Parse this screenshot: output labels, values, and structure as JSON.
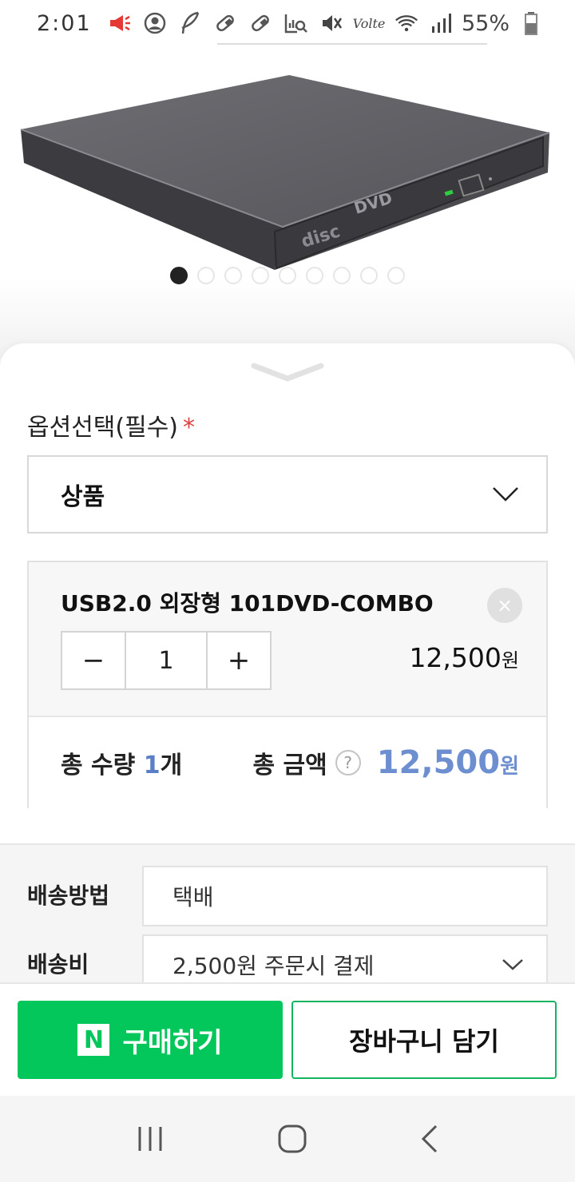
{
  "status_bar": {
    "time": "2:01",
    "battery": "55%",
    "icons_left": [
      "megaphone-icon",
      "account-circle-icon",
      "feather-icon",
      "pill-icon",
      "pill-icon",
      "chart-search-icon"
    ],
    "icons_right": [
      "mute-icon",
      "volte-icon",
      "wifi-icon",
      "signal-icon",
      "battery-icon"
    ],
    "volte_label": "Volte"
  },
  "product_image": {
    "dots_total": 9,
    "active_index": 0
  },
  "option": {
    "label": "옵션선택(필수)",
    "required_mark": "*",
    "selected": "상품"
  },
  "cart_item": {
    "name": "USB2.0 외장형 101DVD-COMBO",
    "quantity": "1",
    "price": "12,500",
    "price_unit": "원",
    "minus": "−",
    "plus": "+",
    "remove": "×"
  },
  "summary": {
    "qty_label": "총 수량",
    "qty_value": "1",
    "qty_unit": "개",
    "amount_label": "총 금액",
    "help": "?",
    "amount_value": "12,500",
    "amount_unit": "원"
  },
  "delivery": {
    "method_label": "배송방법",
    "method_value": "택배",
    "fee_label": "배송비",
    "fee_value": "2,500원 주문시 결제"
  },
  "actions": {
    "buy_logo": "N",
    "buy_label": "구매하기",
    "cart_label": "장바구니 담기"
  },
  "colors": {
    "naver_green": "#03c75a",
    "accent_blue": "#6d8fcf",
    "required_red": "#e0403f"
  }
}
